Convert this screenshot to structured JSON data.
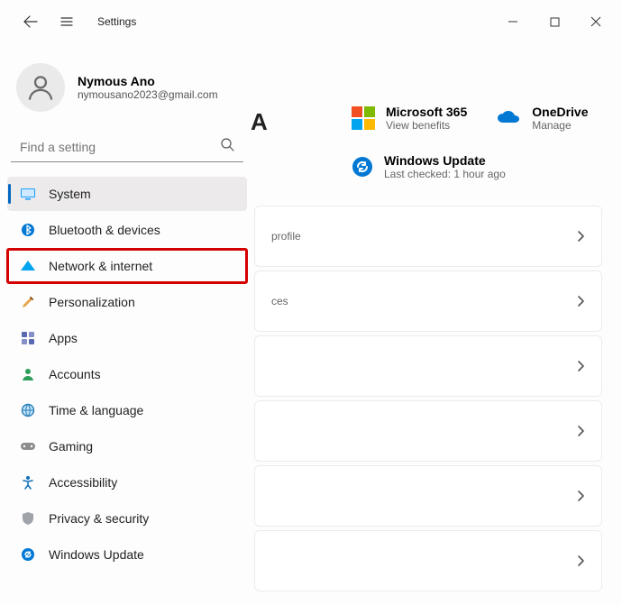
{
  "window": {
    "title": "Settings"
  },
  "user": {
    "name": "Nymous Ano",
    "email": "nymousano2023@gmail.com"
  },
  "search": {
    "placeholder": "Find a setting"
  },
  "sidebar": {
    "items": [
      {
        "label": "System",
        "active": true,
        "highlight": false
      },
      {
        "label": "Bluetooth & devices",
        "active": false,
        "highlight": false
      },
      {
        "label": "Network & internet",
        "active": false,
        "highlight": true
      },
      {
        "label": "Personalization",
        "active": false,
        "highlight": false
      },
      {
        "label": "Apps",
        "active": false,
        "highlight": false
      },
      {
        "label": "Accounts",
        "active": false,
        "highlight": false
      },
      {
        "label": "Time & language",
        "active": false,
        "highlight": false
      },
      {
        "label": "Gaming",
        "active": false,
        "highlight": false
      },
      {
        "label": "Accessibility",
        "active": false,
        "highlight": false
      },
      {
        "label": "Privacy & security",
        "active": false,
        "highlight": false
      },
      {
        "label": "Windows Update",
        "active": false,
        "highlight": false
      }
    ]
  },
  "header_fragment": "A",
  "info": {
    "m365": {
      "title": "Microsoft 365",
      "subtitle": "View benefits"
    },
    "onedrive": {
      "title": "OneDrive",
      "subtitle": "Manage"
    },
    "windows_update": {
      "title": "Windows Update",
      "subtitle": "Last checked: 1 hour ago"
    }
  },
  "cards": [
    {
      "hint": "profile"
    },
    {
      "hint": "ces"
    },
    {
      "hint": ""
    },
    {
      "hint": ""
    },
    {
      "hint": ""
    },
    {
      "hint": ""
    }
  ]
}
